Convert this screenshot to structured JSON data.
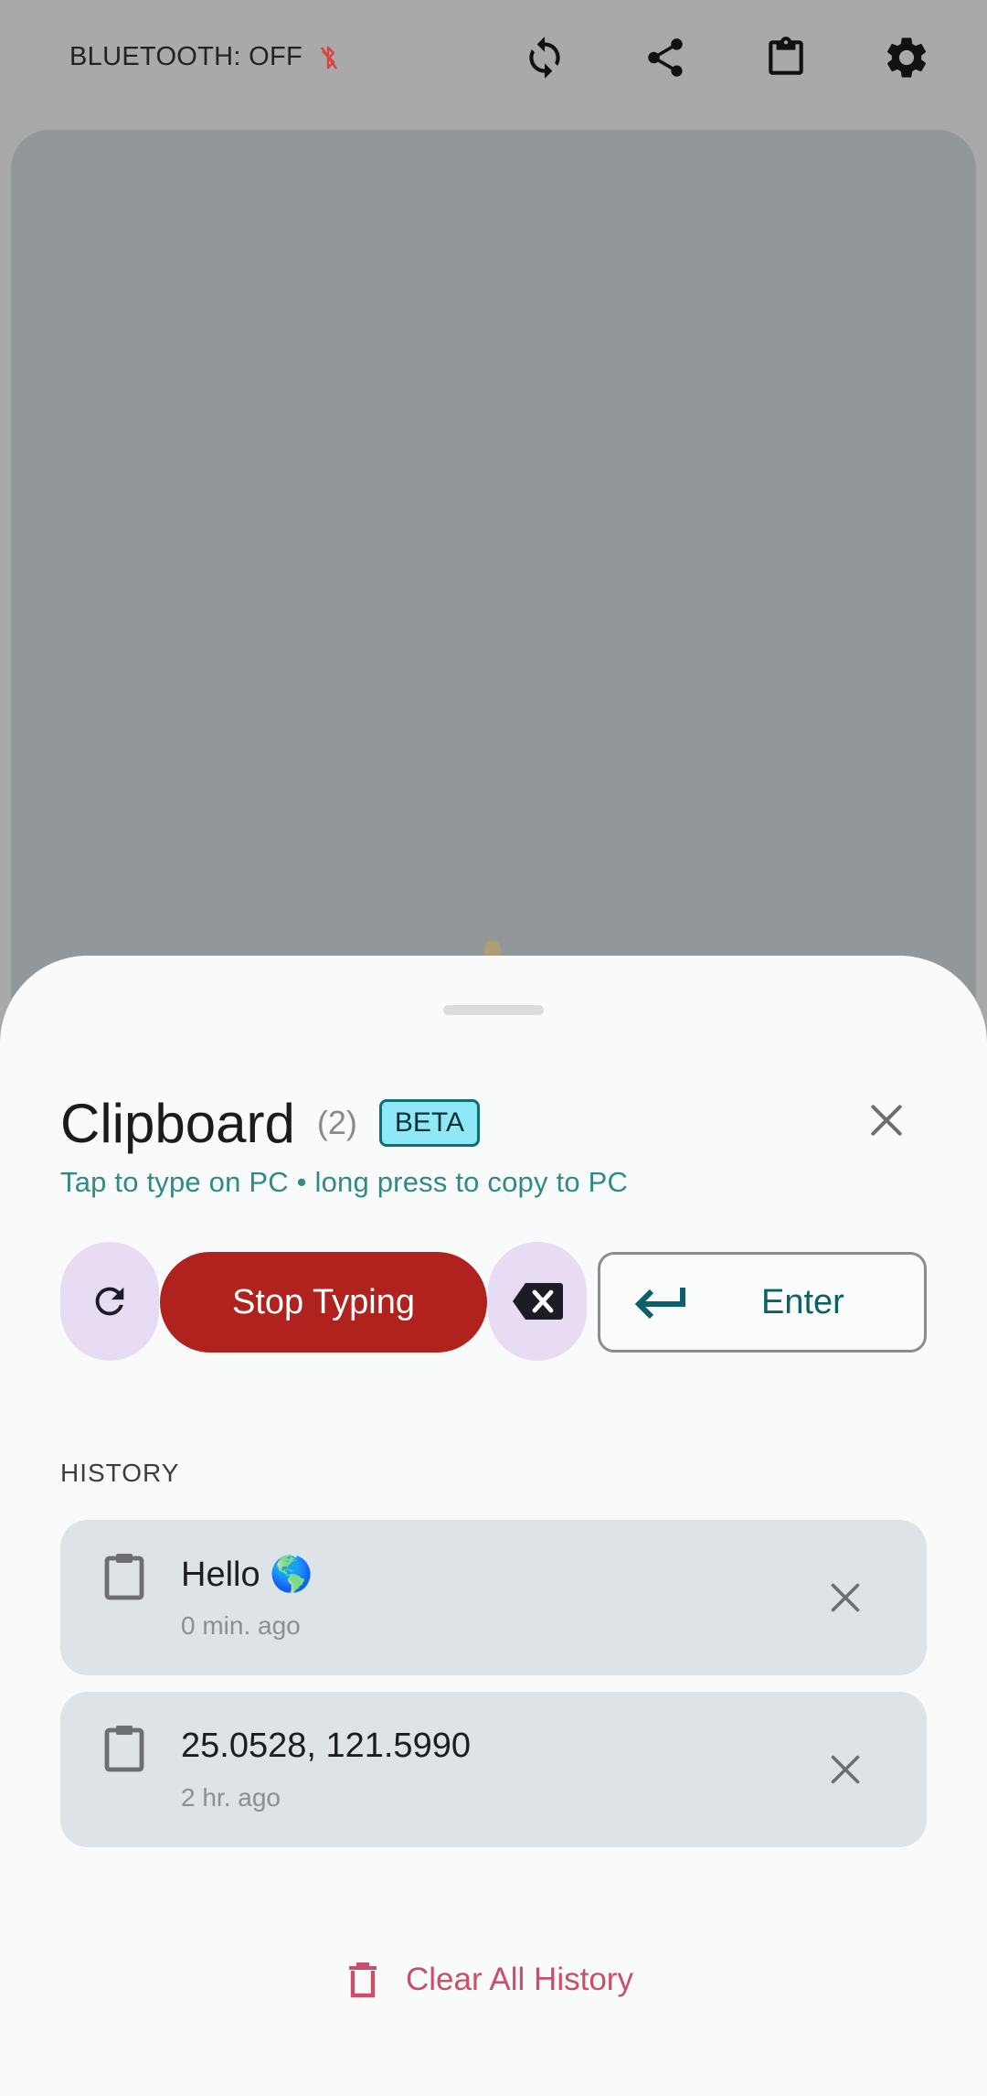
{
  "status_bar": {
    "bluetooth_label": "BLUETOOTH: OFF",
    "icons": [
      "bluetooth-off-icon",
      "sync-icon",
      "share-icon",
      "clipboard-icon",
      "gear-icon"
    ]
  },
  "sheet": {
    "title": "Clipboard",
    "count": "(2)",
    "badge": "BETA",
    "subtitle": "Tap to type on PC • long press to copy to PC",
    "actions": {
      "stop_label": "Stop Typing",
      "enter_label": "Enter"
    },
    "history_label": "HISTORY",
    "history": [
      {
        "text": "Hello 🌎",
        "time": "0 min. ago"
      },
      {
        "text": "25.0528, 121.5990",
        "time": "2 hr. ago"
      }
    ],
    "clear_label": "Clear All History"
  },
  "colors": {
    "stop_button": "#b0221d",
    "accent_teal": "#2f8a88",
    "clear_pink": "#c94f6a",
    "beta_bg": "#8ee8f6"
  }
}
